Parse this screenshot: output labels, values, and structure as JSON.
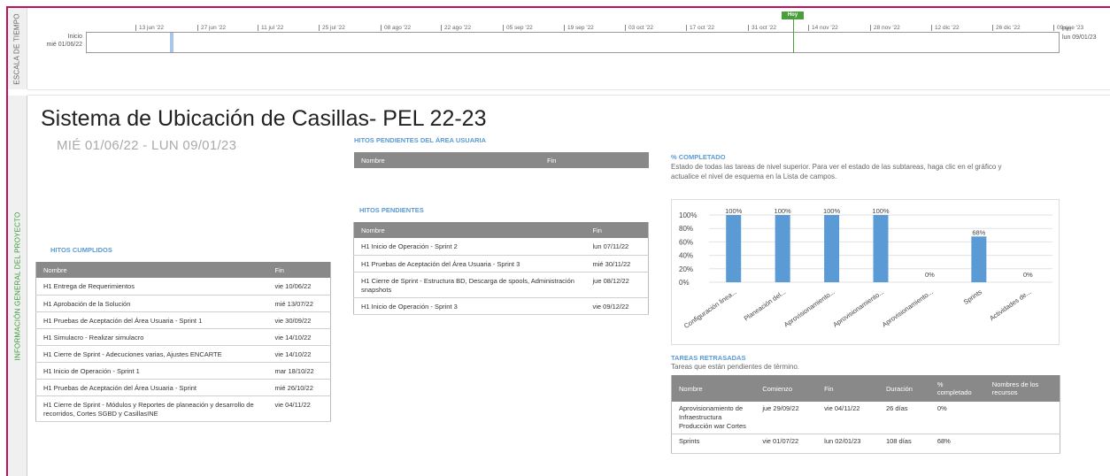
{
  "bands": {
    "timeline": "ESCALA DE TIEMPO",
    "info": "INFORMACIÓN GENERAL DEL PROYECTO"
  },
  "timeline": {
    "start_label": "Inicio",
    "start_date": "mié 01/06/22",
    "end_label": "Fin",
    "end_date": "lun 09/01/23",
    "today_label": "Hoy",
    "ticks": [
      "13 jun '22",
      "27 jun '22",
      "11 jul '22",
      "25 jul '22",
      "08 ago '22",
      "22 ago '22",
      "05 sep '22",
      "19 sep '22",
      "03 oct '22",
      "17 oct '22",
      "31 oct '22",
      "14 nov '22",
      "28 nov '22",
      "12 dic '22",
      "26 dic '22",
      "09 ene '23"
    ]
  },
  "project": {
    "title": "Sistema de Ubicación de Casillas- PEL 22-23",
    "date_range": "MIÉ 01/06/22  -  LUN 09/01/23"
  },
  "hitos_cumplidos": {
    "label": "HITOS CUMPLIDOS",
    "headers": [
      "Nombre",
      "Fin"
    ],
    "rows": [
      [
        "H1 Entrega de Requerimientos",
        "vie 10/06/22"
      ],
      [
        "H1 Aprobación de la Solución",
        "mié 13/07/22"
      ],
      [
        "H1 Pruebas de Aceptación del Área Usuaria - Sprint 1",
        "vie 30/09/22"
      ],
      [
        "H1 Simulacro - Realizar simulacro",
        "vie 14/10/22"
      ],
      [
        "H1 Cierre de Sprint - Adecuciones varias, Ajustes ENCARTE",
        "vie 14/10/22"
      ],
      [
        "H1 Inicio de Operación - Sprint 1",
        "mar 18/10/22"
      ],
      [
        "H1 Pruebas de Aceptación del Área Usuaria - Sprint",
        "mié 26/10/22"
      ],
      [
        "H1 Cierre de Sprint - Módulos y Reportes de planeación y desarrollo de recorridos, Cortes SGBD y CasillasINE",
        "vie 04/11/22"
      ]
    ]
  },
  "hitos_usuaria": {
    "label": "HITOS PENDIENTES DEL ÁREA USUARIA",
    "headers": [
      "Nombre",
      "Fin"
    ]
  },
  "hitos_pendientes": {
    "label": "HITOS PENDIENTES",
    "headers": [
      "Nombre",
      "Fin"
    ],
    "rows": [
      [
        "H1 Inicio de Operación - Sprint 2",
        "lun 07/11/22"
      ],
      [
        "H1 Pruebas de Aceptación del Área Usuaria - Sprint 3",
        "mié 30/11/22"
      ],
      [
        "H1 Cierre de Sprint - Estructura BD, Descarga de spools, Administración snapshots",
        "jue 08/12/22"
      ],
      [
        "H1 Inicio de Operación - Sprint 3",
        "vie 09/12/22"
      ]
    ]
  },
  "completado": {
    "label": "% COMPLETADO",
    "description": "Estado de todas las tareas de nivel superior. Para ver el estado de las subtareas, haga clic en el gráfico y actualice el nivel de esquema en la Lista de campos."
  },
  "chart_data": {
    "type": "bar",
    "categories": [
      "Configuración linea...",
      "Planeación del...",
      "Aprovisionamiento...",
      "Aprovisionamiento...",
      "Aprovisionamiento...",
      "Sprints",
      "Actividades de..."
    ],
    "values": [
      100,
      100,
      100,
      100,
      0,
      68,
      0
    ],
    "data_labels": [
      "100%",
      "100%",
      "100%",
      "100%",
      "0%",
      "68%",
      "0%"
    ],
    "y_ticks": [
      "0%",
      "20%",
      "40%",
      "60%",
      "80%",
      "100%"
    ],
    "ylim": [
      0,
      100
    ],
    "grid": true,
    "bar_color": "#5b9bd5"
  },
  "tareas_retrasadas": {
    "label": "TAREAS RETRASADAS",
    "description": "Tareas que están pendientes de término.",
    "headers": [
      "Nombre",
      "Comienzo",
      "Fin",
      "Duración",
      "% completado",
      "Nombres de los recursos"
    ],
    "rows": [
      [
        "Aprovisionamiento de Infraestructura Producción war Cortes",
        "jue 29/09/22",
        "vie 04/11/22",
        "26 días",
        "0%",
        ""
      ],
      [
        "Sprints",
        "vie 01/07/22",
        "lun 02/01/23",
        "108 días",
        "68%",
        ""
      ]
    ]
  }
}
